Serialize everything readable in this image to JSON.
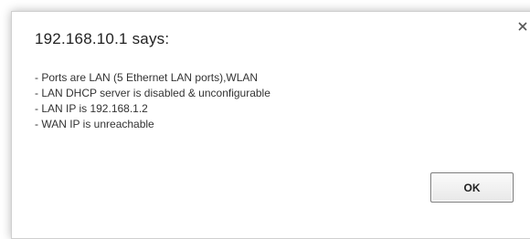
{
  "dialog": {
    "title": "192.168.10.1 says:",
    "close_icon": "close-icon",
    "message_lines": [
      "- Ports are LAN (5 Ethernet LAN ports),WLAN",
      "- LAN DHCP server is disabled & unconfigurable",
      "- LAN IP is 192.168.1.2",
      "- WAN IP is unreachable"
    ],
    "ok_label": "OK"
  }
}
